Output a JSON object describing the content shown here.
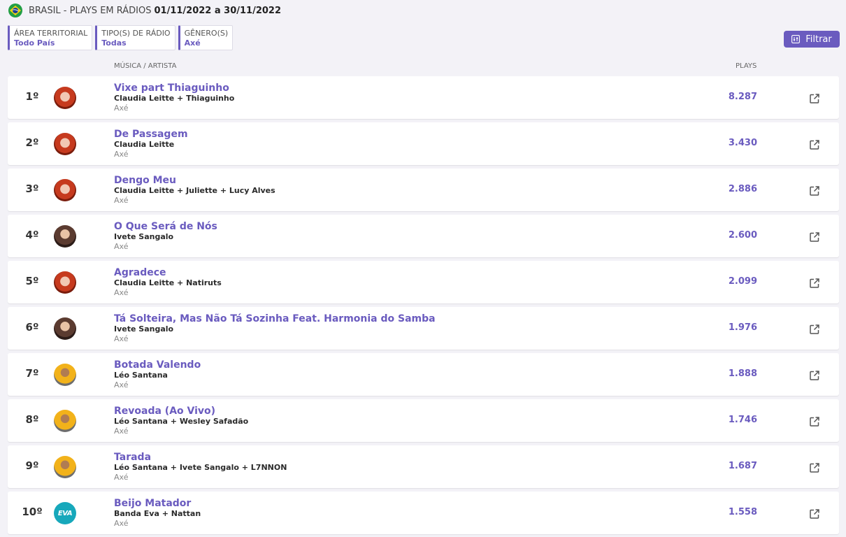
{
  "header": {
    "country": "BRASIL",
    "title": "BRASIL - PLAYS EM RÁDIOS",
    "period": "01/11/2022 a 30/11/2022"
  },
  "filters": [
    {
      "label": "ÁREA TERRITORIAL",
      "value": "Todo País"
    },
    {
      "label": "TIPO(S) DE RÁDIO",
      "value": "Todas"
    },
    {
      "label": "GÊNERO(S)",
      "value": "Axé"
    }
  ],
  "filter_button": "Filtrar",
  "columns": {
    "musica": "MÚSICA / ARTISTA",
    "plays": "PLAYS"
  },
  "rows": [
    {
      "rank": "1º",
      "song": "Vixe part Thiaguinho",
      "artist": "Claudia Leitte + Thiaguinho",
      "genre": "Axé",
      "plays": "8.287",
      "avatar": "claudia"
    },
    {
      "rank": "2º",
      "song": "De Passagem",
      "artist": "Claudia Leitte",
      "genre": "Axé",
      "plays": "3.430",
      "avatar": "claudia"
    },
    {
      "rank": "3º",
      "song": "Dengo Meu",
      "artist": "Claudia Leitte + Juliette + Lucy Alves",
      "genre": "Axé",
      "plays": "2.886",
      "avatar": "claudia"
    },
    {
      "rank": "4º",
      "song": "O Que Será de Nós",
      "artist": "Ivete Sangalo",
      "genre": "Axé",
      "plays": "2.600",
      "avatar": "ivete"
    },
    {
      "rank": "5º",
      "song": "Agradece",
      "artist": "Claudia Leitte + Natiruts",
      "genre": "Axé",
      "plays": "2.099",
      "avatar": "claudia"
    },
    {
      "rank": "6º",
      "song": "Tá Solteira, Mas Não Tá Sozinha Feat. Harmonia do Samba",
      "artist": "Ivete Sangalo",
      "genre": "Axé",
      "plays": "1.976",
      "avatar": "ivete"
    },
    {
      "rank": "7º",
      "song": "Botada Valendo",
      "artist": "Léo Santana",
      "genre": "Axé",
      "plays": "1.888",
      "avatar": "leo"
    },
    {
      "rank": "8º",
      "song": "Revoada (Ao Vivo)",
      "artist": "Léo Santana + Wesley Safadão",
      "genre": "Axé",
      "plays": "1.746",
      "avatar": "leo"
    },
    {
      "rank": "9º",
      "song": "Tarada",
      "artist": "Léo Santana + Ivete Sangalo + L7NNON",
      "genre": "Axé",
      "plays": "1.687",
      "avatar": "leo"
    },
    {
      "rank": "10º",
      "song": "Beijo Matador",
      "artist": "Banda Eva + Nattan",
      "genre": "Axé",
      "plays": "1.558",
      "avatar": "eva",
      "avatar_text": "EVA"
    }
  ],
  "colors": {
    "accent": "#6a5bbf",
    "background": "#f3f2f7"
  }
}
